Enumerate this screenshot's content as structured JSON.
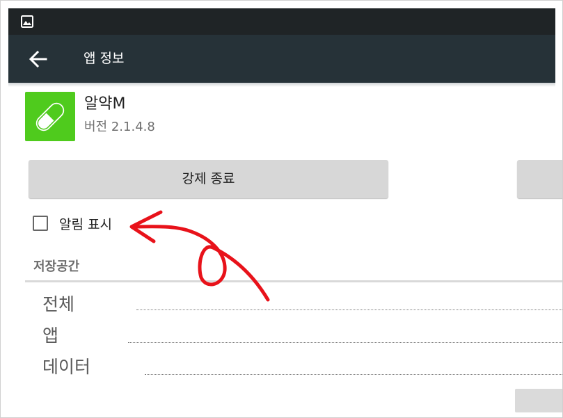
{
  "status_bar": {
    "icon": "image-icon"
  },
  "app_bar": {
    "title": "앱 정보",
    "back_icon": "arrow-left-icon"
  },
  "app": {
    "name": "알약M",
    "version": "버전 2.1.4.8",
    "icon": "pill-icon",
    "icon_color": "#4fcb1d"
  },
  "buttons": {
    "force_stop": "강제 종료"
  },
  "notifications": {
    "label": "알림 표시",
    "checked": false
  },
  "storage": {
    "header": "저장공간",
    "rows": [
      {
        "label": "전체"
      },
      {
        "label": "앱"
      },
      {
        "label": "데이터"
      }
    ]
  },
  "annotation": {
    "color": "#e8121a",
    "shape": "arrow"
  },
  "colors": {
    "app_bar": "#263238",
    "status_bar": "#1f2426",
    "button": "#d7d7d7"
  }
}
